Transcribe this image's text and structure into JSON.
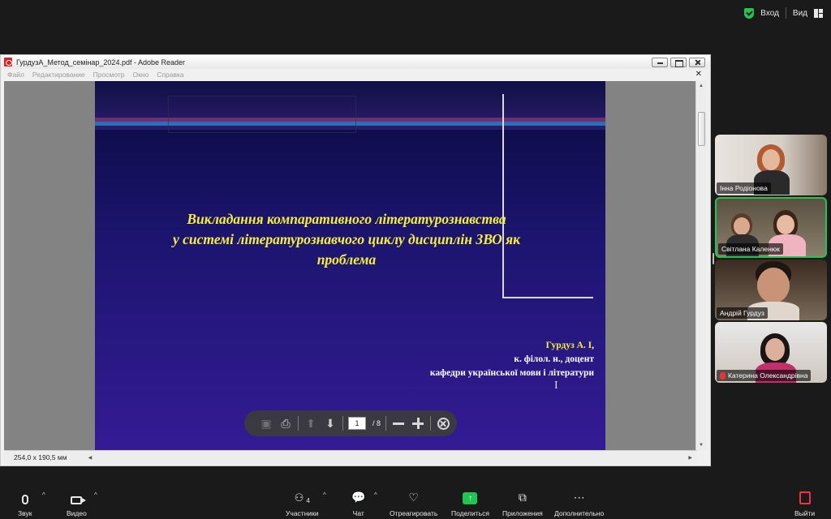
{
  "top": {
    "join_label": "Вход",
    "view_label": "Вид"
  },
  "adobe": {
    "title": "ГурдузА_Метод_семінар_2024.pdf - Adobe Reader",
    "menu": [
      "Файл",
      "Редактирование",
      "Просмотр",
      "Окно",
      "Справка"
    ],
    "page_size": "254,0 x 190,5 мм"
  },
  "slide": {
    "title_lines": [
      "Викладання компаративного літературознавства",
      "у системі літературознавчого циклу дисциплін ЗВО як",
      "проблема"
    ],
    "author_name": "Гурдуз А. І",
    "author_lines": [
      "к. філол. н., доцент",
      "кафедри української мови і літератури"
    ]
  },
  "pdf_toolbar": {
    "current_page": "1",
    "total_pages": "/ 8"
  },
  "participants": [
    {
      "name": "Інна Родіонова"
    },
    {
      "name": "Світлана Каленюк"
    },
    {
      "name": "Андрій Гурдуз"
    },
    {
      "name": "Катерина Олександрівна"
    }
  ],
  "bottom": {
    "audio": "Звук",
    "video": "Видео",
    "participants": "Участники",
    "participants_count": "4",
    "chat": "Чат",
    "react": "Отреагировать",
    "share": "Поделиться",
    "apps": "Приложения",
    "more": "Дополнительно",
    "leave": "Выйти"
  },
  "colors": {
    "accent_green": "#23c552",
    "slide_title_yellow": "#f5ef3c",
    "slide_bg_dark": "#0b0a3e"
  }
}
